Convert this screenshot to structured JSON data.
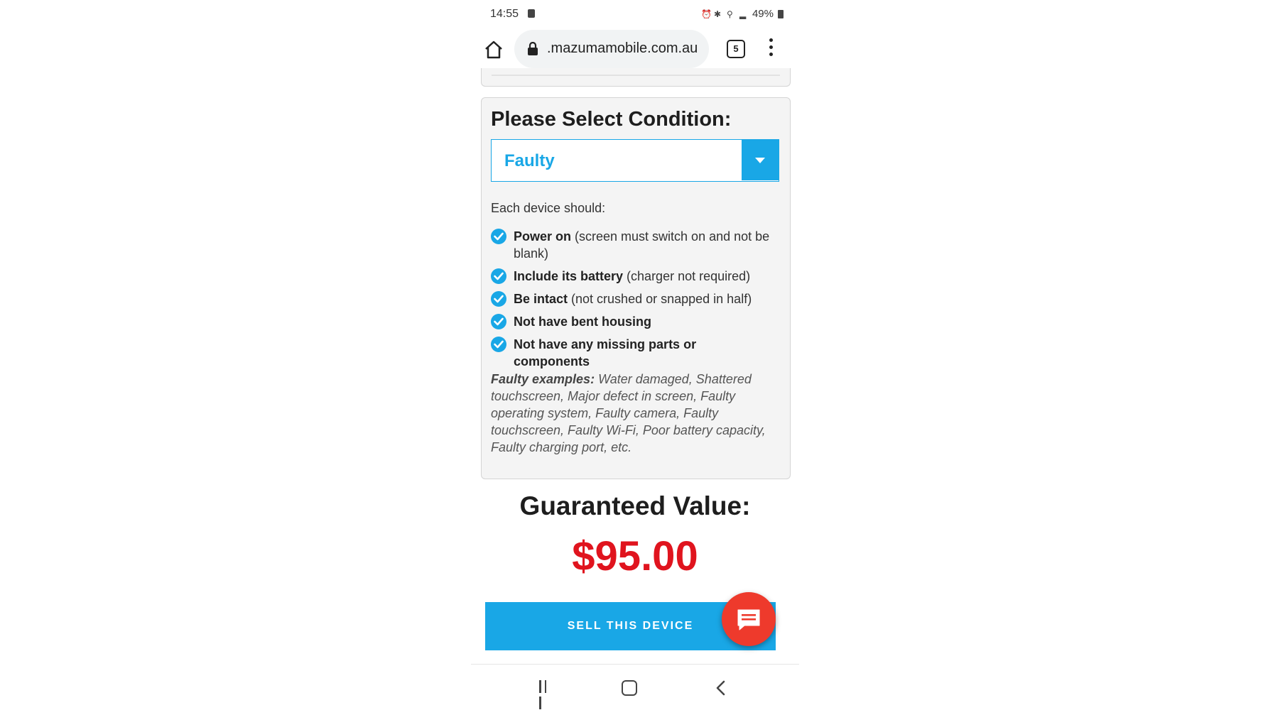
{
  "status_bar": {
    "time": "14:55",
    "battery": "49%"
  },
  "browser": {
    "url": ".mazumamobile.com.au",
    "tab_count": "5"
  },
  "condition": {
    "heading": "Please Select Condition:",
    "selected": "Faulty",
    "intro": "Each device should:",
    "requirements": [
      {
        "bold": "Power on",
        "rest": " (screen must switch on and not be blank)"
      },
      {
        "bold": "Include its battery",
        "rest": " (charger not required)"
      },
      {
        "bold": "Be intact",
        "rest": " (not crushed or snapped in half)"
      },
      {
        "bold": "Not have bent housing",
        "rest": ""
      },
      {
        "bold": "Not have any missing parts or components",
        "rest": ""
      }
    ],
    "examples_label": "Faulty examples:",
    "examples_text": " Water damaged, Shattered touchscreen, Major defect in screen, Faulty operating system, Faulty camera, Faulty touchscreen, Faulty Wi-Fi, Poor battery capacity, Faulty charging port, etc."
  },
  "value": {
    "label": "Guaranteed Value:",
    "price": "$95.00"
  },
  "cta": {
    "sell_label": "SELL THIS DEVICE"
  },
  "icons": {
    "home": "home-icon",
    "lock": "lock-icon",
    "menu": "more-vert-icon",
    "check": "check-circle-icon",
    "dropdown": "caret-down-icon",
    "chat": "chat-icon"
  },
  "colors": {
    "accent": "#19a7e6",
    "price": "#e0141e",
    "chat_fab": "#ee3a2c"
  }
}
